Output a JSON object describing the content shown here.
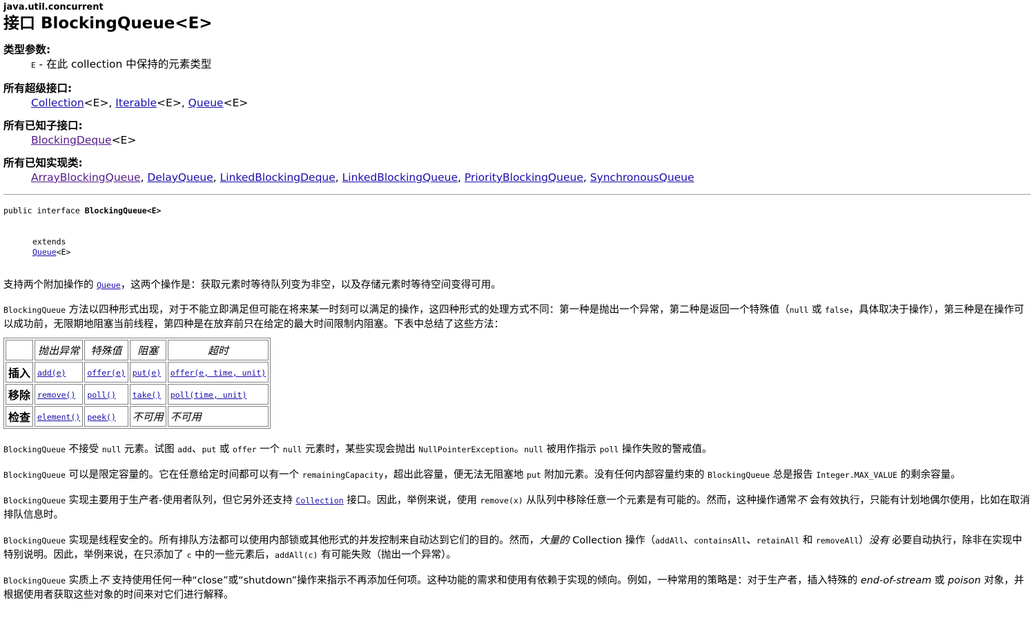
{
  "package": "java.util.concurrent",
  "title": "接口 BlockingQueue<E>",
  "type_params": {
    "heading": "类型参数:",
    "name": "E",
    "desc": " - 在此 collection 中保持的元素类型"
  },
  "superinterfaces": {
    "heading": "所有超级接口:",
    "items": [
      {
        "link": "Collection",
        "suffix": "<E>, "
      },
      {
        "link": "Iterable",
        "suffix": "<E>, "
      },
      {
        "link": "Queue",
        "suffix": "<E>"
      }
    ]
  },
  "subinterfaces": {
    "heading": "所有已知子接口:",
    "items": [
      {
        "link": "BlockingDeque",
        "suffix": "<E>"
      }
    ]
  },
  "implementing": {
    "heading": "所有已知实现类:",
    "items": [
      {
        "link": "ArrayBlockingQueue",
        "suffix": ", "
      },
      {
        "link": "DelayQueue",
        "suffix": ", "
      },
      {
        "link": "LinkedBlockingDeque",
        "suffix": ", "
      },
      {
        "link": "LinkedBlockingQueue",
        "suffix": ", "
      },
      {
        "link": "PriorityBlockingQueue",
        "suffix": ", "
      },
      {
        "link": "SynchronousQueue",
        "suffix": ""
      }
    ]
  },
  "declaration": {
    "prefix": "public interface ",
    "name": "BlockingQueue<E>",
    "extends_kw": "extends",
    "extends_link": "Queue",
    "extends_suffix": "<E>"
  },
  "para1": {
    "a": "支持两个附加操作的 ",
    "link": "Queue",
    "b": "，这两个操作是：获取元素时等待队列变为非空，以及存储元素时等待空间变得可用。"
  },
  "para2": {
    "code1": "BlockingQueue",
    "a": " 方法以四种形式出现，对于不能立即满足但可能在将来某一时刻可以满足的操作，这四种形式的处理方式不同：第一种是抛出一个异常，第二种是返回一个特殊值（",
    "code2": "null",
    "b": " 或 ",
    "code3": "false",
    "c": "，具体取决于操作），第三种是在操作可以成功前，无限期地阻塞当前线程，第四种是在放弃前只在给定的最大时间限制内阻塞。下表中总结了这些方法："
  },
  "table": {
    "headers": [
      "",
      "抛出异常",
      "特殊值",
      "阻塞",
      "超时"
    ],
    "rows": [
      {
        "label": "插入",
        "cells": [
          "add(e)",
          "offer(e)",
          "put(e)",
          "offer(e, time, unit)"
        ]
      },
      {
        "label": "移除",
        "cells": [
          "remove()",
          "poll()",
          "take()",
          "poll(time, unit)"
        ]
      },
      {
        "label": "检查",
        "cells": [
          "element()",
          "peek()",
          "不可用",
          "不可用"
        ]
      }
    ]
  },
  "para3": {
    "c1": "BlockingQueue",
    "t1": " 不接受 ",
    "c2": "null",
    "t2": " 元素。试图 ",
    "c3": "add",
    "t3": "、",
    "c4": "put",
    "t4": " 或 ",
    "c5": "offer",
    "t5": " 一个 ",
    "c6": "null",
    "t6": " 元素时，某些实现会抛出 ",
    "c7": "NullPointerException",
    "t7": "。",
    "c8": "null",
    "t8": " 被用作指示 ",
    "c9": "poll",
    "t9": " 操作失败的警戒值。"
  },
  "para4": {
    "c1": "BlockingQueue",
    "t1": " 可以是限定容量的。它在任意给定时间都可以有一个 ",
    "c2": "remainingCapacity",
    "t2": "，超出此容量，便无法无阻塞地 ",
    "c3": "put",
    "t3": " 附加元素。没有任何内部容量约束的 ",
    "c4": "BlockingQueue",
    "t4": " 总是报告 ",
    "c5": "Integer.MAX_VALUE",
    "t5": " 的剩余容量。"
  },
  "para5": {
    "c1": "BlockingQueue",
    "t1": " 实现主要用于生产者-使用者队列，但它另外还支持 ",
    "link": "Collection",
    "t2": " 接口。因此，举例来说，使用 ",
    "c2": "remove(x)",
    "t3": " 从队列中移除任意一个元素是有可能的。然而，这种操作通常",
    "i1": "不",
    "t4": " 会有效执行，只能有计划地偶尔使用，比如在取消排队信息时。"
  },
  "para6": {
    "c1": "BlockingQueue",
    "t1": " 实现是线程安全的。所有排队方法都可以使用内部锁或其他形式的并发控制来自动达到它们的目的。然而，",
    "i1": "大量的",
    "t2": " Collection 操作（",
    "c2": "addAll",
    "t3": "、",
    "c3": "containsAll",
    "t4": "、",
    "c4": "retainAll",
    "t5": " 和 ",
    "c5": "removeAll",
    "t6": "）",
    "i2": "没有",
    "t7": " 必要自动执行，除非在实现中特别说明。因此，举例来说，在只添加了 ",
    "c6": "c",
    "t8": " 中的一些元素后，",
    "c7": "addAll(c)",
    "t9": " 有可能失败（抛出一个异常）。"
  },
  "para7": {
    "c1": "BlockingQueue",
    "t1": " 实质上",
    "i1": "不",
    "t2": " 支持使用任何一种“close”或“shutdown”操作来指示不再添加任何项。这种功能的需求和使用有依赖于实现的倾向。例如，一种常用的策略是：对于生产者，插入特殊的 ",
    "i2": "end-of-stream",
    "t3": " 或 ",
    "i3": "poison",
    "t4": " 对象，并根据使用者获取这些对象的时间来对它们进行解释。"
  }
}
